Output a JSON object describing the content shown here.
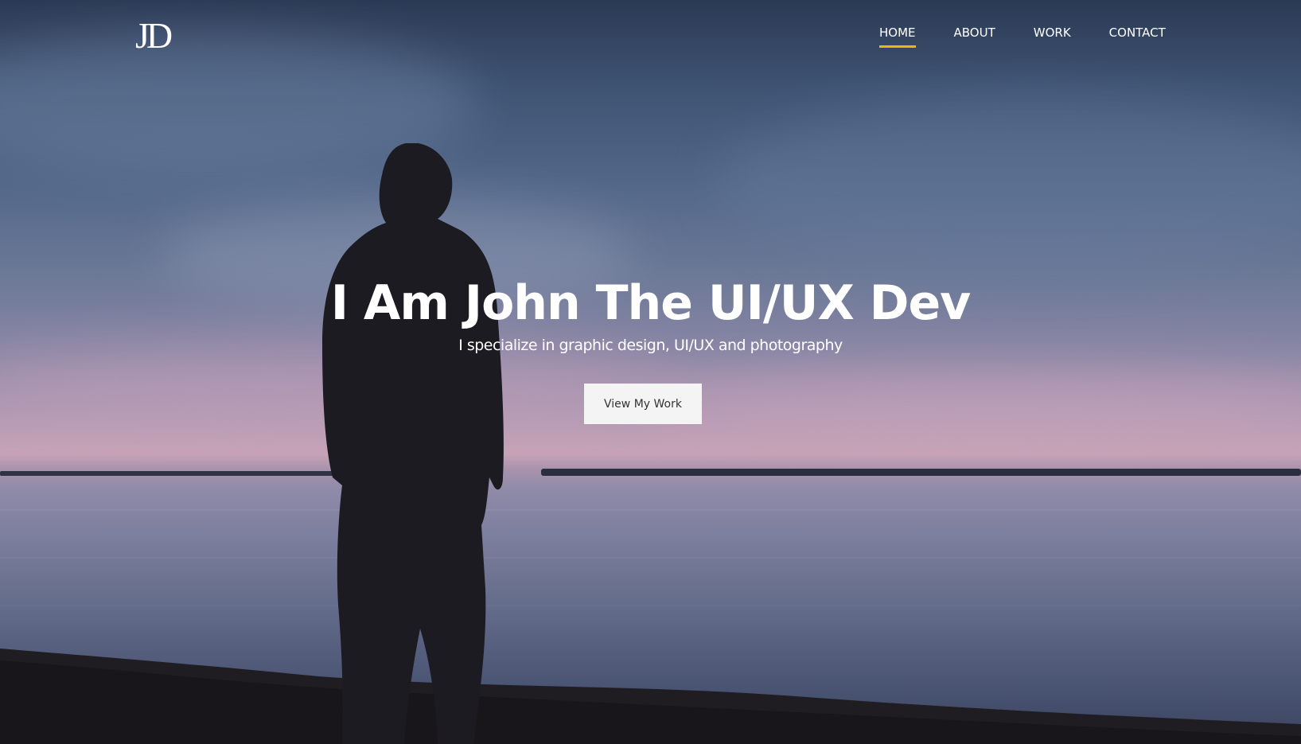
{
  "header": {
    "logo_text": "JD",
    "nav": [
      {
        "label": "HOME",
        "active": true
      },
      {
        "label": "ABOUT",
        "active": false
      },
      {
        "label": "WORK",
        "active": false
      },
      {
        "label": "CONTACT",
        "active": false
      }
    ]
  },
  "hero": {
    "title": "I Am John The UI/UX Dev",
    "subtitle": "I specialize in graphic design, UI/UX and photography",
    "cta_label": "View My Work",
    "background_image": "silhouette-of-man-by-lake-at-dusk"
  },
  "colors": {
    "accent": "#f2b705",
    "text": "#ffffff",
    "button_bg": "#f4f4f4",
    "button_text": "#333333"
  }
}
